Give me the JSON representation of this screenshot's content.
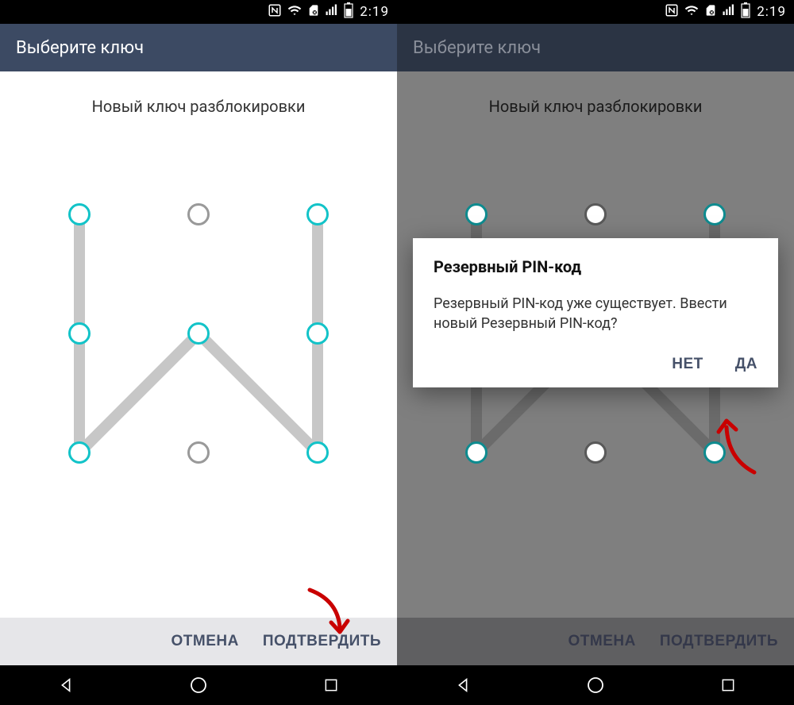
{
  "statusbar": {
    "time": "2:19"
  },
  "titlebar": {
    "title": "Выберите ключ"
  },
  "instruction": "Новый ключ разблокировки",
  "footer": {
    "cancel": "ОТМЕНА",
    "confirm": "ПОДТВЕРДИТЬ"
  },
  "dialog": {
    "title": "Резервный PIN-код",
    "body": "Резервный PIN-код уже существует. Ввести новый Резервный PIN-код?",
    "no": "НЕТ",
    "yes": "ДА"
  },
  "pattern": {
    "active_dots": [
      0,
      2,
      3,
      4,
      5,
      6,
      8
    ],
    "path": [
      [
        0,
        0
      ],
      [
        0,
        1
      ],
      [
        0,
        2
      ],
      [
        1,
        1
      ],
      [
        2,
        2
      ],
      [
        2,
        1
      ],
      [
        2,
        0
      ]
    ]
  },
  "colors": {
    "accent": "#12c3c8",
    "header": "#3c4a63",
    "buttonText": "#465169",
    "arrow": "#c90000"
  }
}
